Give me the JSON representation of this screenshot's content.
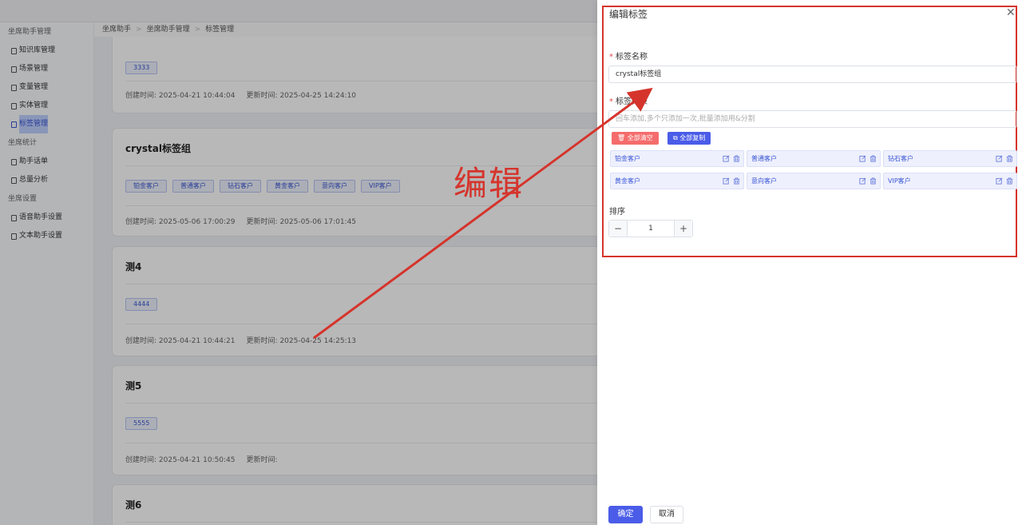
{
  "sidebar": {
    "groups": [
      {
        "label": "坐席助手管理",
        "items": [
          "知识库管理",
          "场景管理",
          "变量管理",
          "实体管理",
          "标签管理"
        ]
      },
      {
        "label": "坐席统计",
        "items": [
          "助手话单",
          "总量分析"
        ]
      },
      {
        "label": "坐席设置",
        "items": [
          "语音助手设置",
          "文本助手设置"
        ]
      }
    ],
    "active_item": "标签管理"
  },
  "breadcrumb": [
    "坐席助手",
    "坐席助手管理",
    "标签管理"
  ],
  "cards": [
    {
      "title": "",
      "tags": [
        "3333"
      ],
      "created_label": "创建时间:",
      "created": "2025-04-21 10:44:04",
      "updated_label": "更新时间:",
      "updated": "2025-04-25 14:24:10"
    },
    {
      "title": "crystal标签组",
      "tags": [
        "铂金客户",
        "普通客户",
        "钻石客户",
        "黄金客户",
        "意向客户",
        "VIP客户"
      ],
      "created_label": "创建时间:",
      "created": "2025-05-06 17:00:29",
      "updated_label": "更新时间:",
      "updated": "2025-05-06 17:01:45"
    },
    {
      "title": "测4",
      "tags": [
        "4444"
      ],
      "created_label": "创建时间:",
      "created": "2025-04-21 10:44:21",
      "updated_label": "更新时间:",
      "updated": "2025-04-25 14:25:13"
    },
    {
      "title": "测5",
      "tags": [
        "5555"
      ],
      "created_label": "创建时间:",
      "created": "2025-04-21 10:50:45",
      "updated_label": "更新时间:",
      "updated": ""
    },
    {
      "title": "测6",
      "tags": [],
      "created_label": "",
      "created": "",
      "updated_label": "",
      "updated": ""
    }
  ],
  "drawer": {
    "title": "编辑标签",
    "name_label": "标签名称",
    "name_value": "crystal标签组",
    "list_label": "标签列表",
    "list_placeholder": "回车添加,多个只添加一次,批量添加用&分割",
    "clear_all": "全部清空",
    "copy_all": "全部复制",
    "tag_items": [
      "铂金客户",
      "普通客户",
      "钻石客户",
      "黄金客户",
      "意向客户",
      "VIP客户"
    ],
    "sort_label": "排序",
    "sort_value": "1",
    "confirm": "确定",
    "cancel": "取消"
  },
  "annotation": {
    "text": "编辑",
    "color": "#d5342c"
  },
  "colors": {
    "primary": "#4a5ce8",
    "danger": "#f56c6c",
    "highlight": "#d5342c"
  }
}
